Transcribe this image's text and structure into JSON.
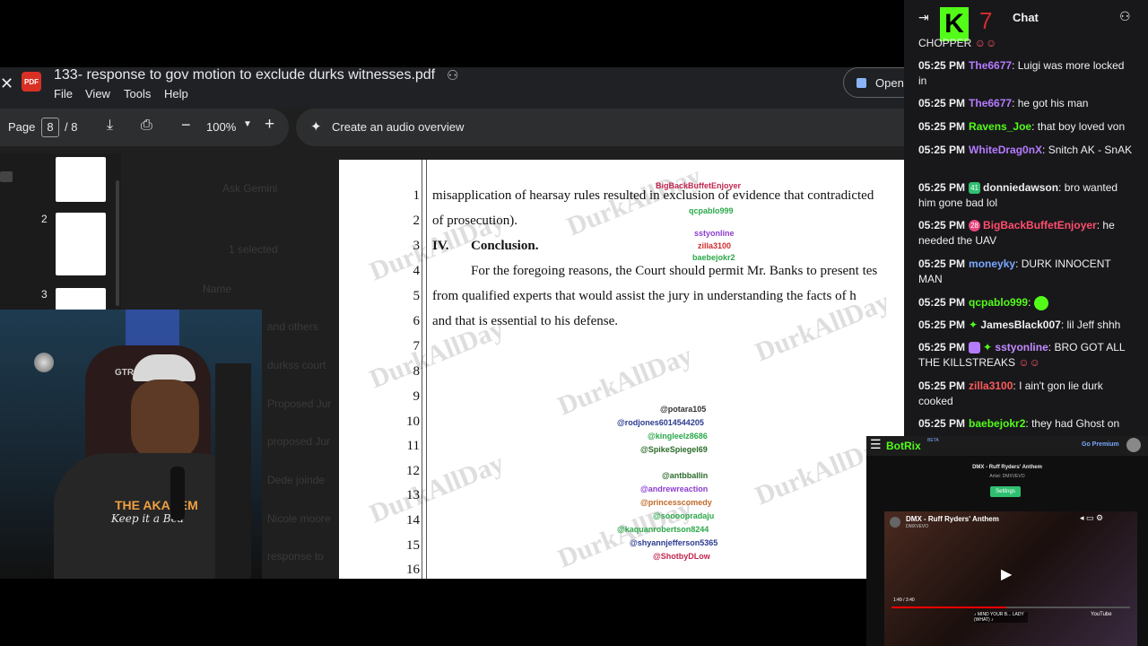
{
  "pdf": {
    "title": "133- response to gov motion to exclude durks witnesses.pdf",
    "menus": [
      "File",
      "View",
      "Tools",
      "Help"
    ],
    "open_label": "Open",
    "page_label": "Page",
    "current_page": "8",
    "page_total": "/ 8",
    "zoom": "100%",
    "audio_overview": "Create an audio overview",
    "thumb_numbers": [
      "2",
      "3"
    ],
    "ghost_text": [
      "Ask Gemini",
      "1 selected",
      "Name",
      "and others",
      "durkss court",
      "Proposed Jur",
      "proposed Jur",
      "Dede joinde",
      "Nicole moore",
      "response to"
    ]
  },
  "document": {
    "line_numbers": [
      "1",
      "2",
      "3",
      "4",
      "5",
      "6",
      "7",
      "8",
      "9",
      "10",
      "11",
      "12",
      "13",
      "14",
      "15",
      "16"
    ],
    "lines": [
      "misapplication of hearsay rules resulted in exclusion of evidence that contradicted",
      "of prosecution).",
      "",
      "For the foregoing reasons, the Court should permit Mr. Banks to present tes",
      "from qualified experts that would assist the jury in understanding the facts of h",
      "and that is essential to his defense."
    ],
    "section_number": "IV.",
    "section_title": "Conclusion.",
    "watermark": "DurkAllDay"
  },
  "overlay_chat": {
    "users": [
      "BigBackBuffetEnjoyer",
      "qcpablo999",
      "sstyonline",
      "zilla3100",
      "baebejokr2"
    ],
    "yt_users": [
      "@potara105",
      "@rodjones6014544205",
      "@kingleelz8686",
      "@SpikeSpiegel69",
      "@antbballin",
      "@andrewreaction",
      "@princesscomedy",
      "@soooopradaju",
      "@kaquanrobertson8244",
      "@shyannjefferson5365",
      "@ShotbyDLow"
    ]
  },
  "chat": {
    "title": "Chat",
    "logo_text": "K",
    "logo_num": "7",
    "first_line": "CHOPPER",
    "messages": [
      {
        "time": "05:25 PM",
        "user": "The6677",
        "color": "#b57bff",
        "text": "Luigi was more locked in"
      },
      {
        "time": "05:25 PM",
        "user": "The6677",
        "color": "#b57bff",
        "text": "he got his man"
      },
      {
        "time": "05:25 PM",
        "user": "Ravens_Joe",
        "color": "#53fc18",
        "text": "that boy loved von"
      },
      {
        "time": "05:25 PM",
        "user": "WhiteDrag0nX",
        "color": "#b57bff",
        "text": "Snitch AK - SnAK"
      },
      {
        "time": "05:25 PM",
        "user": "donniedawson",
        "color": "#efeff1",
        "text": "bro wanted him gone bad lol",
        "badge": "41",
        "badge_color": "#2fbf71"
      },
      {
        "time": "05:25 PM",
        "user": "BigBackBuffetEnjoyer",
        "color": "#ff4d6d",
        "text": "he needed the UAV",
        "badge": "28",
        "badge_color": "#e8467c"
      },
      {
        "time": "05:25 PM",
        "user": "moneyky",
        "color": "#7aa7ff",
        "text": "DURK INNOCENT MAN"
      },
      {
        "time": "05:25 PM",
        "user": "qcpablo999",
        "color": "#53fc18",
        "text": ""
      },
      {
        "time": "05:25 PM",
        "user": "JamesBlack007",
        "color": "#efeff1",
        "text": "lil Jeff shhh"
      },
      {
        "time": "05:25 PM",
        "user": "sstyonline",
        "color": "#c48bff",
        "text": "BRO GOT ALL THE KILLSTREAKS"
      },
      {
        "time": "05:25 PM",
        "user": "zilla3100",
        "color": "#ff5a5a",
        "text": "I ain't gon lie durk cooked"
      },
      {
        "time": "05:25 PM",
        "user": "baebejokr2",
        "color": "#53fc18",
        "text": "they had Ghost on"
      }
    ]
  },
  "webcam": {
    "shirt_text": "THE AKADEM",
    "shirt_sub": "Keep it a Bea",
    "chair_text": "GTR"
  },
  "botrix": {
    "brand": "BotRix",
    "beta": "BETA",
    "go_premium": "Go Premium",
    "song_title": "DMX - Ruff Ryders' Anthem",
    "artist_label": "Artist",
    "artist": "DMXVEVO",
    "settings": "Settings",
    "video_title": "DMX - Ruff Ryders' Anthem",
    "video_channel": "DMXVEVO",
    "time": "1:49 / 3:40",
    "caption": "♪ MIND YOUR B... LADY (WHAT) ♪",
    "youtube": "YouTube"
  }
}
